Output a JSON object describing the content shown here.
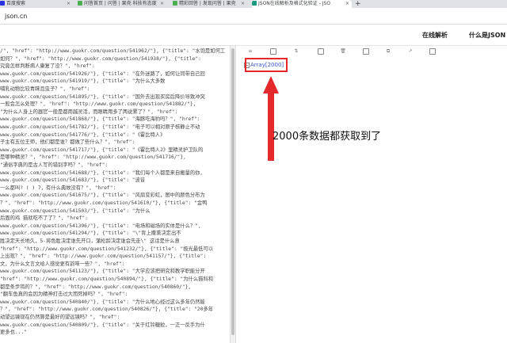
{
  "browser": {
    "tabs": [
      {
        "title": "百度搜索",
        "active": false
      },
      {
        "title": "问答首页 | 问答 | 果壳 科技有态度",
        "active": false
      },
      {
        "title": "精彩回答 | 发现问答 | 果壳",
        "active": false
      },
      {
        "title": "JSON在线解析及格式化验证 - JSO",
        "active": true
      }
    ],
    "new_tab_label": "+",
    "url": "json.cn"
  },
  "site_nav": {
    "parse_link": "在线解析",
    "what_is_json_link": "什么是JSON"
  },
  "editor": {
    "lines": [
      "/\", \"href\": \"http://www.guokr.com/question/541962/\"}, {\"title\": \"水饱是如何工",
      "如何？\", \"href\": \"http://www.guokr.com/question/541938/\"}, {\"title\":",
      "究竟怎样判断病人康复了没？\", \"href\":",
      "www.guokr.com/question/541926/\"}, {\"title\": \"在外迷路了，如何让同带自己回",
      "www.guokr.com/question/541919/\"}, {\"title\": \"为什么大多数",
      "哺乳动物比较青睐且虫子？\", \"href\":",
      "www.guokr.com/question/541895/\"}, {\"title\": \"国外去出现买房后降价导致冲突",
      "一般会怎么处理？\", \"href\": \"http://www.guokr.com/question/541882/\"},",
      "\"为什么人身上的器官一般是都用越灵活，而眼睛用多了两说累了？\", \"href\":",
      "www.guokr.com/question/541868/\"}, {\"title\": \"海豚吃海豹吗？\", \"href\":",
      "www.guokr.com/question/541782/\"}, {\"title\": \"电子可以相对原子核静止不动",
      "www.guokr.com/question/541776/\"}, {\"title\": \"《霍比特人》",
      "子主有五位王师，他们都是谁？都做了些什么？\", \"href\":",
      "www.guokr.com/question/541717/\"}, {\"title\": \"《霍比特人2》里精灵护卫队的",
      "是哪种精灵？\", \"href\": \"http://www.guokr.com/question/541716/\"},",
      "\"通俗字典的是古人写的错别字吗？\", \"href\":",
      "www.guokr.com/question/541688/\"}, {\"title\": \"我们每个人都是来自搬量的你，",
      "www.guokr.com/question/541683/\"}, {\"title\": \"波音",
      "一么都叫? ( ) 7，有什么典故没有？\", \"href\":",
      "www.guokr.com/question/541675/\"}, {\"title\": \"风扇变彩虹，图中的颜色分布为",
      "？\", \"href\": \"http://www.guokr.com/question/541610/\"}, {\"title\": \"金鸭",
      "www.guokr.com/question/541503/\"}, {\"title\": \"为什么",
      "后面的鸡 猫就吃不了了？\", \"href\":",
      "www.guokr.com/question/541396/\"}, {\"title\": \"电场和磁场的实体是什么？\",",
      "www.guokr.com/question/541294/\"}, {\"title\": \"\\\"背上撒熏决定出不",
      "胜决定天长地久，5-将色胜决定谁先开口，蒲松龄决定谁会先走\\\" 这话是什么意",
      "\"href\": \"http://www.guokr.com/question/541232/\"}, {\"title\": \"极光最低可以",
      "上出现？\", \"href\": \"http://www.guokr.com/question/541157/\"}, {\"title\":",
      "文，为什么文言文给人感觉更有韵味一些？\", \"href\":",
      "www.guokr.com/question/541123/\"}, {\"title\": \"大学应该把研究和教学职能分开",
      "\"href\": \"http://www.guokr.com/question/540894/\"}, {\"title\": \"为什么猫科和",
      "都是条步鸣的？\", \"href\": \"http://www.guokr.com/question/540860/\"},",
      "\"翻车鱼真的会因为精神打击过大而死掉吗？\", \"href\":",
      "www.guokr.com/question/540840/\"}, {\"title\": \"为什么地心经过这么多年仍然能",
      "？\", \"href\": \"http://www.guokr.com/question/540826/\"}, {\"title\": \"20多年",
      "动望远镜现在仍然算是最好的望远镜吗？\", \"href\":",
      "www.guokr.com/question/540809/\"}, {\"title\": \"关于红铃糖粒，一正一反手为什",
      "更多也...\""
    ]
  },
  "toolbar": {
    "icons": [
      "expand-all-icon",
      "copy-icon",
      "sort-icon",
      "compress-icon",
      "clear-icon",
      "format-icon",
      "save-icon",
      "expand-icon",
      "share-icon"
    ]
  },
  "tree": {
    "toggle": "−",
    "node_label": "Array[2000]"
  },
  "annotation": {
    "text": "2000条数据都获取到了",
    "color": "#e5282c"
  },
  "colors": {
    "accent_red": "#e5282c",
    "tab_bar": "#dee1e6"
  }
}
